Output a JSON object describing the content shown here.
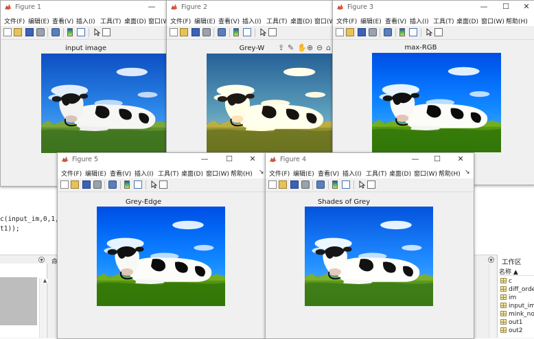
{
  "desktop": {
    "code_lines": [
      "c(input_im,0,1,0",
      "t1));"
    ],
    "command_panel_label": "命",
    "workspace": {
      "title": "工作区",
      "column_header": "名称 ▲",
      "variables": [
        "c",
        "diff_orde",
        "im",
        "input_im",
        "mink_no",
        "out1",
        "out2"
      ]
    }
  },
  "figures": [
    {
      "id": "fig1",
      "title": "Figure 1",
      "axes_title": "input image",
      "filter": "none"
    },
    {
      "id": "fig2",
      "title": "Figure 2",
      "axes_title": "Grey-W",
      "filter": "warm"
    },
    {
      "id": "fig3",
      "title": "Figure 3",
      "axes_title": "max-RGB",
      "filter": "cool"
    },
    {
      "id": "fig5",
      "title": "Figure 5",
      "axes_title": "Grey-Edge",
      "filter": "cool"
    },
    {
      "id": "fig4",
      "title": "Figure 4",
      "axes_title": "Shades of Grey",
      "filter": "soft"
    }
  ],
  "menu": [
    "文件(F)",
    "编辑(E)",
    "查看(V)",
    "插入(I)",
    "工具(T)",
    "桌面(D)",
    "窗口(W)",
    "帮助(H)"
  ],
  "menu_more_glyph": "↘",
  "window_buttons": {
    "minimize": "—",
    "maximize": "☐",
    "close": "✕"
  },
  "icons": {
    "toolbar": [
      "new-figure-icon",
      "open-file-icon",
      "save-icon",
      "print-icon",
      "link-plot-icon",
      "insert-colorbar-icon",
      "insert-legend-icon",
      "edit-plot-pointer-icon",
      "property-inspector-icon"
    ],
    "axes_toolbar": [
      "export-icon",
      "brush-icon",
      "pan-hand-icon",
      "zoom-in-icon",
      "zoom-out-icon",
      "home-icon"
    ]
  },
  "colors": {
    "accent_logo": "#e8532a",
    "sky": "#1f70d8",
    "grass": "#4f8a28"
  }
}
